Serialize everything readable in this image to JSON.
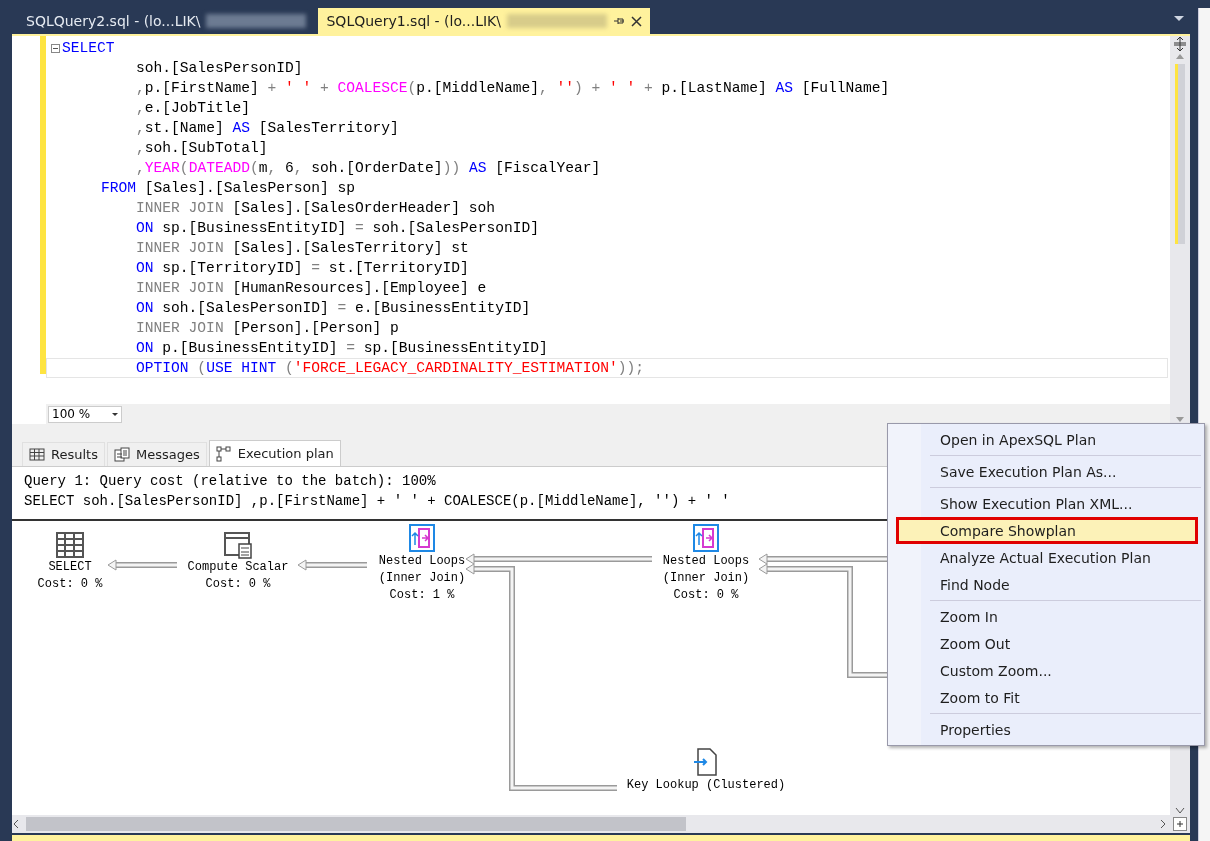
{
  "document_tabs": [
    {
      "label": "SQLQuery2.sql - (lo...LIK\\",
      "selected": false,
      "redacted": true
    },
    {
      "label": "SQLQuery1.sql - (lo...LIK\\",
      "selected": true,
      "redacted": true
    }
  ],
  "editor": {
    "lines": [
      {
        "current": false,
        "collapsible": true,
        "segments": [
          {
            "text": "SELECT",
            "kind": "keyword"
          }
        ]
      },
      {
        "current": false,
        "collapsible": false,
        "segments": [
          {
            "text": "        soh.[SalesPersonID]",
            "kind": "plain"
          }
        ]
      },
      {
        "current": false,
        "collapsible": false,
        "segments": [
          {
            "text": "        ,",
            "kind": "operator"
          },
          {
            "text": "p.[FirstName] ",
            "kind": "plain"
          },
          {
            "text": "+ ",
            "kind": "operator"
          },
          {
            "text": "' '",
            "kind": "string"
          },
          {
            "text": " + ",
            "kind": "operator"
          },
          {
            "text": "COALESCE",
            "kind": "function"
          },
          {
            "text": "(",
            "kind": "operator"
          },
          {
            "text": "p.[MiddleName]",
            "kind": "plain"
          },
          {
            "text": ", ",
            "kind": "operator"
          },
          {
            "text": "''",
            "kind": "string"
          },
          {
            "text": ") + ",
            "kind": "operator"
          },
          {
            "text": "' '",
            "kind": "string"
          },
          {
            "text": " + ",
            "kind": "operator"
          },
          {
            "text": "p.[LastName] ",
            "kind": "plain"
          },
          {
            "text": "AS",
            "kind": "keyword"
          },
          {
            "text": " [FullName]",
            "kind": "plain"
          }
        ]
      },
      {
        "current": false,
        "collapsible": false,
        "segments": [
          {
            "text": "        ,",
            "kind": "operator"
          },
          {
            "text": "e.[JobTitle]",
            "kind": "plain"
          }
        ]
      },
      {
        "current": false,
        "collapsible": false,
        "segments": [
          {
            "text": "        ,",
            "kind": "operator"
          },
          {
            "text": "st.[Name] ",
            "kind": "plain"
          },
          {
            "text": "AS",
            "kind": "keyword"
          },
          {
            "text": " [SalesTerritory]",
            "kind": "plain"
          }
        ]
      },
      {
        "current": false,
        "collapsible": false,
        "segments": [
          {
            "text": "        ,",
            "kind": "operator"
          },
          {
            "text": "soh.[SubTotal]",
            "kind": "plain"
          }
        ]
      },
      {
        "current": false,
        "collapsible": false,
        "segments": [
          {
            "text": "        ,",
            "kind": "operator"
          },
          {
            "text": "YEAR",
            "kind": "function"
          },
          {
            "text": "(",
            "kind": "operator"
          },
          {
            "text": "DATEADD",
            "kind": "function"
          },
          {
            "text": "(",
            "kind": "operator"
          },
          {
            "text": "m",
            "kind": "plain"
          },
          {
            "text": ", ",
            "kind": "operator"
          },
          {
            "text": "6",
            "kind": "plain"
          },
          {
            "text": ", ",
            "kind": "operator"
          },
          {
            "text": "soh.[OrderDate]",
            "kind": "plain"
          },
          {
            "text": "))",
            "kind": "operator"
          },
          {
            "text": " AS",
            "kind": "keyword"
          },
          {
            "text": " [FiscalYear]",
            "kind": "plain"
          }
        ]
      },
      {
        "current": false,
        "collapsible": false,
        "segments": [
          {
            "text": "    FROM",
            "kind": "keyword"
          },
          {
            "text": " [Sales].[SalesPerson] sp",
            "kind": "plain"
          }
        ]
      },
      {
        "current": false,
        "collapsible": false,
        "segments": [
          {
            "text": "        INNER JOIN",
            "kind": "operator"
          },
          {
            "text": " [Sales].[SalesOrderHeader] soh",
            "kind": "plain"
          }
        ]
      },
      {
        "current": false,
        "collapsible": false,
        "segments": [
          {
            "text": "        ON",
            "kind": "keyword"
          },
          {
            "text": " sp.[BusinessEntityID] ",
            "kind": "plain"
          },
          {
            "text": "=",
            "kind": "operator"
          },
          {
            "text": " soh.[SalesPersonID]",
            "kind": "plain"
          }
        ]
      },
      {
        "current": false,
        "collapsible": false,
        "segments": [
          {
            "text": "        INNER JOIN",
            "kind": "operator"
          },
          {
            "text": " [Sales].[SalesTerritory] st",
            "kind": "plain"
          }
        ]
      },
      {
        "current": false,
        "collapsible": false,
        "segments": [
          {
            "text": "        ON",
            "kind": "keyword"
          },
          {
            "text": " sp.[TerritoryID] ",
            "kind": "plain"
          },
          {
            "text": "=",
            "kind": "operator"
          },
          {
            "text": " st.[TerritoryID]",
            "kind": "plain"
          }
        ]
      },
      {
        "current": false,
        "collapsible": false,
        "segments": [
          {
            "text": "        INNER JOIN",
            "kind": "operator"
          },
          {
            "text": " [HumanResources].[Employee] e",
            "kind": "plain"
          }
        ]
      },
      {
        "current": false,
        "collapsible": false,
        "segments": [
          {
            "text": "        ON",
            "kind": "keyword"
          },
          {
            "text": " soh.[SalesPersonID] ",
            "kind": "plain"
          },
          {
            "text": "=",
            "kind": "operator"
          },
          {
            "text": " e.[BusinessEntityID]",
            "kind": "plain"
          }
        ]
      },
      {
        "current": false,
        "collapsible": false,
        "segments": [
          {
            "text": "        INNER JOIN",
            "kind": "operator"
          },
          {
            "text": " [Person].[Person] p",
            "kind": "plain"
          }
        ]
      },
      {
        "current": false,
        "collapsible": false,
        "segments": [
          {
            "text": "        ON",
            "kind": "keyword"
          },
          {
            "text": " p.[BusinessEntityID] ",
            "kind": "plain"
          },
          {
            "text": "=",
            "kind": "operator"
          },
          {
            "text": " sp.[BusinessEntityID]",
            "kind": "plain"
          }
        ]
      },
      {
        "current": true,
        "collapsible": false,
        "segments": [
          {
            "text": "        OPTION",
            "kind": "keyword"
          },
          {
            "text": " (",
            "kind": "operator"
          },
          {
            "text": "USE HINT",
            "kind": "keyword"
          },
          {
            "text": " (",
            "kind": "operator"
          },
          {
            "text": "'FORCE_LEGACY_CARDINALITY_ESTIMATION'",
            "kind": "string"
          },
          {
            "text": "));",
            "kind": "operator"
          }
        ]
      }
    ],
    "zoom": "100 %"
  },
  "result_tabs": [
    {
      "label": "Results",
      "selected": false
    },
    {
      "label": "Messages",
      "selected": false
    },
    {
      "label": "Execution plan",
      "selected": true
    }
  ],
  "plan": {
    "header": [
      "Query 1: Query cost (relative to the batch): 100%",
      "SELECT soh.[SalesPersonID] ,p.[FirstName] + ' ' + COALESCE(p.[MiddleName], '') + ' '"
    ],
    "nodes": [
      {
        "kind": "select",
        "lines": [
          "SELECT",
          "Cost: 0 %"
        ]
      },
      {
        "kind": "compute",
        "lines": [
          "Compute Scalar",
          "Cost: 0 %"
        ]
      },
      {
        "kind": "loops",
        "lines": [
          "Nested Loops",
          "(Inner Join)",
          "Cost: 1 %"
        ]
      },
      {
        "kind": "loops",
        "lines": [
          "Nested Loops",
          "(Inner Join)",
          "Cost: 0 %"
        ]
      },
      {
        "kind": "lookup",
        "lines": [
          "Key Lookup (Clustered)"
        ]
      }
    ]
  },
  "context_menu": [
    {
      "label": "Open in ApexSQL Plan",
      "selected": false,
      "separated": false
    },
    {
      "label": "Save Execution Plan As...",
      "selected": false,
      "separated": true
    },
    {
      "label": "Show Execution Plan XML...",
      "selected": false,
      "separated": true
    },
    {
      "label": "Compare Showplan",
      "selected": true,
      "separated": false
    },
    {
      "label": "Analyze Actual Execution Plan",
      "selected": false,
      "separated": false
    },
    {
      "label": "Find Node",
      "selected": false,
      "separated": false
    },
    {
      "label": "Zoom In",
      "selected": false,
      "separated": true
    },
    {
      "label": "Zoom Out",
      "selected": false,
      "separated": false
    },
    {
      "label": "Custom Zoom...",
      "selected": false,
      "separated": false
    },
    {
      "label": "Zoom to Fit",
      "selected": false,
      "separated": false
    },
    {
      "label": "Properties",
      "selected": false,
      "separated": true
    }
  ]
}
